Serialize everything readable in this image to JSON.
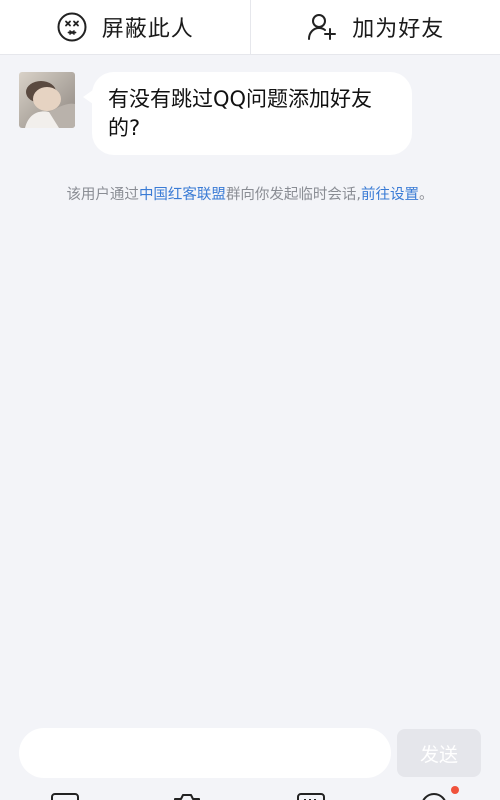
{
  "action_bar": {
    "block": {
      "label": "屏蔽此人",
      "icon": "dizzy-face-icon"
    },
    "add_friend": {
      "label": "加为好友",
      "icon": "add-user-icon"
    }
  },
  "message": {
    "text": "有没有跳过QQ问题添加好友的?"
  },
  "notice": {
    "prefix": "该用户通过",
    "group_link": "中国红客联盟",
    "middle": "群向你发起临时会话,",
    "settings_link": "前往设置",
    "suffix": "。"
  },
  "composer": {
    "input_value": "",
    "send_label": "发送"
  },
  "toolbar": {
    "items": [
      "image-icon",
      "camera-icon",
      "gif-icon",
      "emoji-icon"
    ]
  },
  "colors": {
    "background": "#f3f4f8",
    "link": "#3a7bd5",
    "badge": "#f0523c"
  }
}
